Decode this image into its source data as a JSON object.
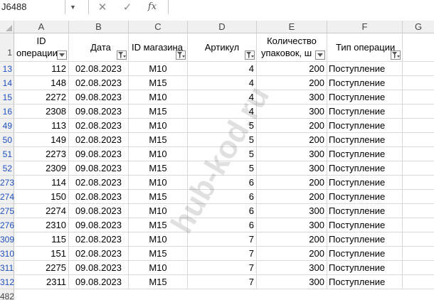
{
  "formula_bar": {
    "name_box": "J6488",
    "cancel_icon": "✕",
    "enter_icon": "✓",
    "fx_label": "fx"
  },
  "columns": [
    "A",
    "B",
    "C",
    "D",
    "E",
    "F",
    "G"
  ],
  "header_row": {
    "row_number": "1",
    "cells": [
      "ID\nоперации",
      "Дата",
      "ID магазина",
      "Артикул",
      "Количество\nупаковок, шт",
      "Тип операции"
    ]
  },
  "rows": [
    {
      "num": "13",
      "a": "112",
      "b": "02.08.2023",
      "c": "M10",
      "d": "4",
      "e": "200",
      "f": "Поступление"
    },
    {
      "num": "14",
      "a": "148",
      "b": "02.08.2023",
      "c": "M15",
      "d": "4",
      "e": "200",
      "f": "Поступление"
    },
    {
      "num": "15",
      "a": "2272",
      "b": "09.08.2023",
      "c": "M10",
      "d": "4",
      "e": "300",
      "f": "Поступление"
    },
    {
      "num": "16",
      "a": "2308",
      "b": "09.08.2023",
      "c": "M15",
      "d": "4",
      "e": "300",
      "f": "Поступление"
    },
    {
      "num": "49",
      "a": "113",
      "b": "02.08.2023",
      "c": "M10",
      "d": "5",
      "e": "200",
      "f": "Поступление"
    },
    {
      "num": "50",
      "a": "149",
      "b": "02.08.2023",
      "c": "M15",
      "d": "5",
      "e": "200",
      "f": "Поступление"
    },
    {
      "num": "51",
      "a": "2273",
      "b": "09.08.2023",
      "c": "M10",
      "d": "5",
      "e": "300",
      "f": "Поступление"
    },
    {
      "num": "52",
      "a": "2309",
      "b": "09.08.2023",
      "c": "M15",
      "d": "5",
      "e": "300",
      "f": "Поступление"
    },
    {
      "num": "273",
      "a": "114",
      "b": "02.08.2023",
      "c": "M10",
      "d": "6",
      "e": "200",
      "f": "Поступление"
    },
    {
      "num": "274",
      "a": "150",
      "b": "02.08.2023",
      "c": "M15",
      "d": "6",
      "e": "200",
      "f": "Поступление"
    },
    {
      "num": "275",
      "a": "2274",
      "b": "09.08.2023",
      "c": "M10",
      "d": "6",
      "e": "300",
      "f": "Поступление"
    },
    {
      "num": "276",
      "a": "2310",
      "b": "09.08.2023",
      "c": "M15",
      "d": "6",
      "e": "300",
      "f": "Поступление"
    },
    {
      "num": "309",
      "a": "115",
      "b": "02.08.2023",
      "c": "M10",
      "d": "7",
      "e": "200",
      "f": "Поступление"
    },
    {
      "num": "310",
      "a": "151",
      "b": "02.08.2023",
      "c": "M15",
      "d": "7",
      "e": "200",
      "f": "Поступление"
    },
    {
      "num": "311",
      "a": "2275",
      "b": "09.08.2023",
      "c": "M10",
      "d": "7",
      "e": "300",
      "f": "Поступление"
    },
    {
      "num": "312",
      "a": "2311",
      "b": "09.08.2023",
      "c": "M15",
      "d": "7",
      "e": "300",
      "f": "Поступление"
    }
  ],
  "partial_row_number": "482",
  "watermark": "hub-kod.ru",
  "colors": {
    "row_number_filtered": "#1f4fbf",
    "header_bg": "#f0f0f0",
    "gridline": "#d9d9d9"
  },
  "icons": {
    "filter_active": "filter-funnel-icon",
    "filter_dropdown": "dropdown-arrow-icon"
  }
}
